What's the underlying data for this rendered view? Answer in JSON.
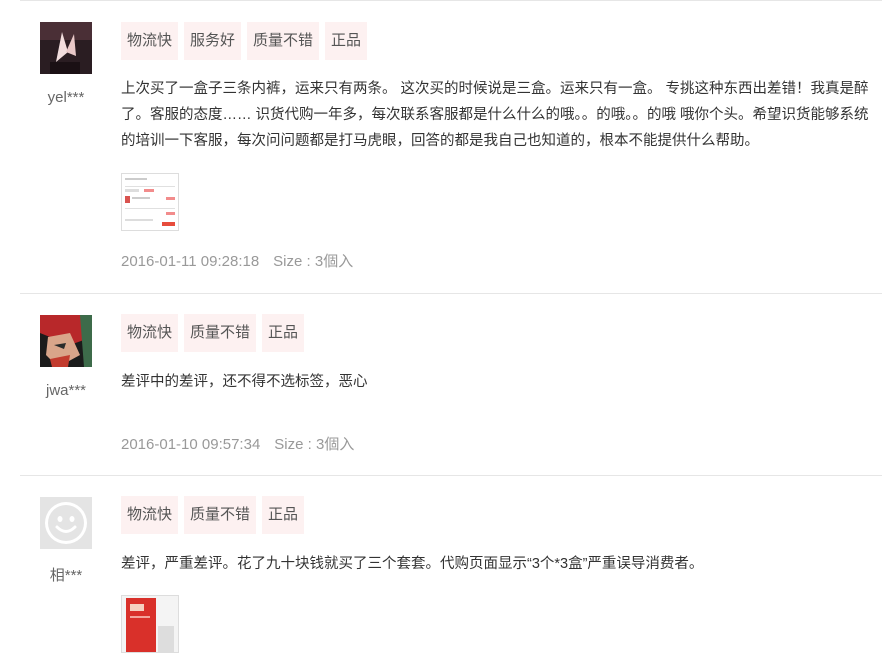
{
  "reviews": [
    {
      "username": "yel***",
      "tags": [
        "物流快",
        "服务好",
        "质量不错",
        "正品"
      ],
      "text": "上次买了一盒子三条内裤，运来只有两条。 这次买的时候说是三盒。运来只有一盒。 专挑这种东西出差错！我真是醉了。客服的态度…… 识货代购一年多，每次联系客服都是什么什么的哦。。的哦。。的哦 哦你个头。希望识货能够系统的培训一下客服，每次问问题都是打马虎眼，回答的都是我自己也知道的，根本不能提供什么帮助。",
      "date": "2016-01-11 09:28:18",
      "size": "Size : 3個入"
    },
    {
      "username": "jwa***",
      "tags": [
        "物流快",
        "质量不错",
        "正品"
      ],
      "text": "差评中的差评，还不得不选标签，恶心",
      "date": "2016-01-10 09:57:34",
      "size": "Size : 3個入"
    },
    {
      "username": "相***",
      "tags": [
        "物流快",
        "质量不错",
        "正品"
      ],
      "text": "差评，严重差评。花了九十块钱就买了三个套套。代购页面显示“3个*3盒”严重误导消费者。"
    }
  ]
}
